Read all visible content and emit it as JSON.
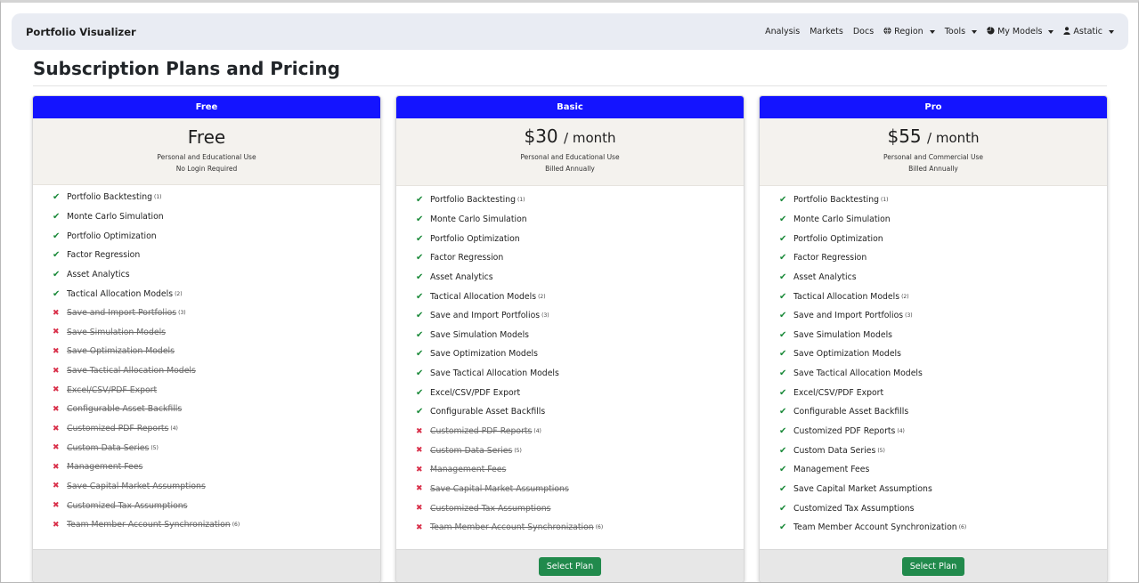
{
  "navbar": {
    "brand": "Portfolio Visualizer",
    "items": [
      {
        "label": "Analysis",
        "dropdown": false,
        "icon": ""
      },
      {
        "label": "Markets",
        "dropdown": false,
        "icon": ""
      },
      {
        "label": "Docs",
        "dropdown": false,
        "icon": ""
      },
      {
        "label": "Region",
        "dropdown": true,
        "icon": "globe-icon"
      },
      {
        "label": "Tools",
        "dropdown": true,
        "icon": ""
      },
      {
        "label": "My Models",
        "dropdown": true,
        "icon": "pie-chart-icon"
      },
      {
        "label": "Astatic",
        "dropdown": true,
        "icon": "user-icon"
      }
    ]
  },
  "page": {
    "title": "Subscription Plans and Pricing"
  },
  "colors": {
    "header_blue": "#1414ff",
    "check_green": "#1b8a3a",
    "cross_red": "#d9304a",
    "button_green": "#218a4c"
  },
  "plans": [
    {
      "name": "Free",
      "price": "Free",
      "per": "",
      "sub1": "Personal and Educational Use",
      "sub2": "No Login Required",
      "button": "",
      "features": [
        {
          "text": "Portfolio Backtesting",
          "note": "(1)",
          "included": true
        },
        {
          "text": "Monte Carlo Simulation",
          "note": "",
          "included": true
        },
        {
          "text": "Portfolio Optimization",
          "note": "",
          "included": true
        },
        {
          "text": "Factor Regression",
          "note": "",
          "included": true
        },
        {
          "text": "Asset Analytics",
          "note": "",
          "included": true
        },
        {
          "text": "Tactical Allocation Models",
          "note": "(2)",
          "included": true
        },
        {
          "text": "Save and Import Portfolios",
          "note": "(3)",
          "included": false
        },
        {
          "text": "Save Simulation Models",
          "note": "",
          "included": false
        },
        {
          "text": "Save Optimization Models",
          "note": "",
          "included": false
        },
        {
          "text": "Save Tactical Allocation Models",
          "note": "",
          "included": false
        },
        {
          "text": "Excel/CSV/PDF Export",
          "note": "",
          "included": false
        },
        {
          "text": "Configurable Asset Backfills",
          "note": "",
          "included": false
        },
        {
          "text": "Customized PDF Reports",
          "note": "(4)",
          "included": false
        },
        {
          "text": "Custom Data Series",
          "note": "(5)",
          "included": false
        },
        {
          "text": "Management Fees",
          "note": "",
          "included": false
        },
        {
          "text": "Save Capital Market Assumptions",
          "note": "",
          "included": false
        },
        {
          "text": "Customized Tax Assumptions",
          "note": "",
          "included": false
        },
        {
          "text": "Team Member Account Synchronization",
          "note": "(6)",
          "included": false
        }
      ]
    },
    {
      "name": "Basic",
      "price": "$30",
      "per": "/ month",
      "sub1": "Personal and Educational Use",
      "sub2": "Billed Annually",
      "button": "Select Plan",
      "features": [
        {
          "text": "Portfolio Backtesting",
          "note": "(1)",
          "included": true
        },
        {
          "text": "Monte Carlo Simulation",
          "note": "",
          "included": true
        },
        {
          "text": "Portfolio Optimization",
          "note": "",
          "included": true
        },
        {
          "text": "Factor Regression",
          "note": "",
          "included": true
        },
        {
          "text": "Asset Analytics",
          "note": "",
          "included": true
        },
        {
          "text": "Tactical Allocation Models",
          "note": "(2)",
          "included": true
        },
        {
          "text": "Save and Import Portfolios",
          "note": "(3)",
          "included": true
        },
        {
          "text": "Save Simulation Models",
          "note": "",
          "included": true
        },
        {
          "text": "Save Optimization Models",
          "note": "",
          "included": true
        },
        {
          "text": "Save Tactical Allocation Models",
          "note": "",
          "included": true
        },
        {
          "text": "Excel/CSV/PDF Export",
          "note": "",
          "included": true
        },
        {
          "text": "Configurable Asset Backfills",
          "note": "",
          "included": true
        },
        {
          "text": "Customized PDF Reports",
          "note": "(4)",
          "included": false
        },
        {
          "text": "Custom Data Series",
          "note": "(5)",
          "included": false
        },
        {
          "text": "Management Fees",
          "note": "",
          "included": false
        },
        {
          "text": "Save Capital Market Assumptions",
          "note": "",
          "included": false
        },
        {
          "text": "Customized Tax Assumptions",
          "note": "",
          "included": false
        },
        {
          "text": "Team Member Account Synchronization",
          "note": "(6)",
          "included": false
        }
      ]
    },
    {
      "name": "Pro",
      "price": "$55",
      "per": "/ month",
      "sub1": "Personal and Commercial Use",
      "sub2": "Billed Annually",
      "button": "Select Plan",
      "features": [
        {
          "text": "Portfolio Backtesting",
          "note": "(1)",
          "included": true
        },
        {
          "text": "Monte Carlo Simulation",
          "note": "",
          "included": true
        },
        {
          "text": "Portfolio Optimization",
          "note": "",
          "included": true
        },
        {
          "text": "Factor Regression",
          "note": "",
          "included": true
        },
        {
          "text": "Asset Analytics",
          "note": "",
          "included": true
        },
        {
          "text": "Tactical Allocation Models",
          "note": "(2)",
          "included": true
        },
        {
          "text": "Save and Import Portfolios",
          "note": "(3)",
          "included": true
        },
        {
          "text": "Save Simulation Models",
          "note": "",
          "included": true
        },
        {
          "text": "Save Optimization Models",
          "note": "",
          "included": true
        },
        {
          "text": "Save Tactical Allocation Models",
          "note": "",
          "included": true
        },
        {
          "text": "Excel/CSV/PDF Export",
          "note": "",
          "included": true
        },
        {
          "text": "Configurable Asset Backfills",
          "note": "",
          "included": true
        },
        {
          "text": "Customized PDF Reports",
          "note": "(4)",
          "included": true
        },
        {
          "text": "Custom Data Series",
          "note": "(5)",
          "included": true
        },
        {
          "text": "Management Fees",
          "note": "",
          "included": true
        },
        {
          "text": "Save Capital Market Assumptions",
          "note": "",
          "included": true
        },
        {
          "text": "Customized Tax Assumptions",
          "note": "",
          "included": true
        },
        {
          "text": "Team Member Account Synchronization",
          "note": "(6)",
          "included": true
        }
      ]
    }
  ]
}
